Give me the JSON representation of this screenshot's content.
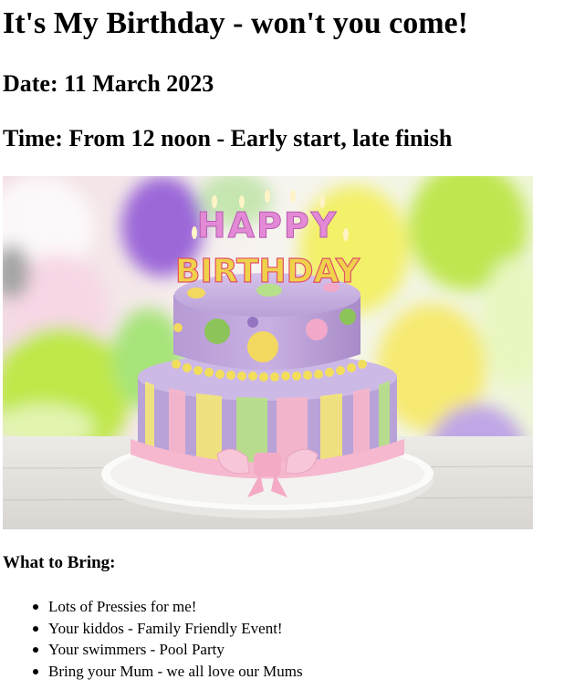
{
  "page": {
    "title": "It's My Birthday - won't you come!",
    "date_line": "Date: 11 March 2023",
    "time_line": "Time: From 12 noon - Early start, late finish"
  },
  "image": {
    "topper_line1": "HAPPY",
    "topper_line2": "BIRTHDAY"
  },
  "bring": {
    "heading": "What to Bring:",
    "items": [
      "Lots of Pressies for me!",
      "Your kiddos - Family Friendly Event!",
      "Your swimmers - Pool Party",
      "Bring your Mum - we all love our Mums"
    ]
  }
}
